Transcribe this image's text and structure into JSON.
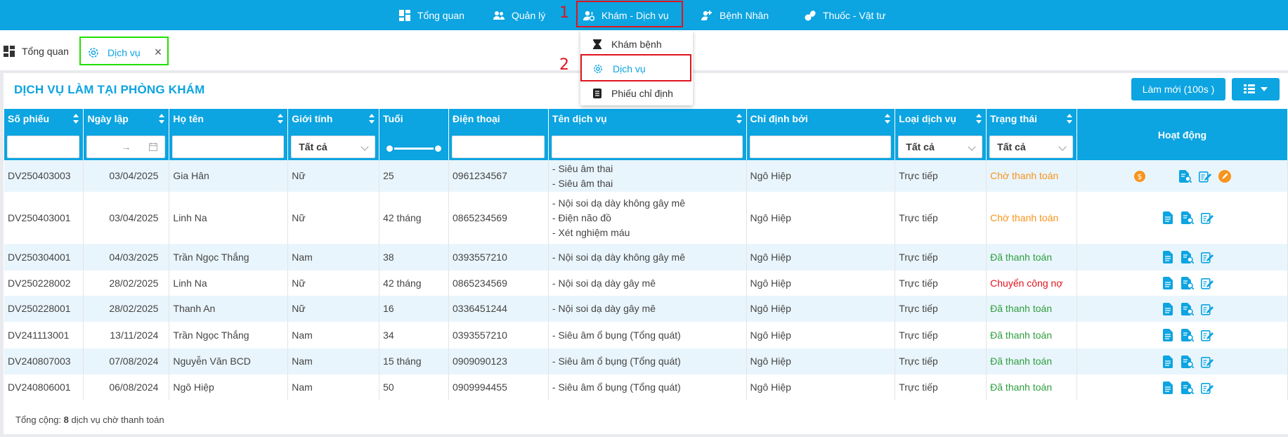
{
  "nav": {
    "items": [
      {
        "label": "Tổng quan",
        "icon": "dashboard-icon"
      },
      {
        "label": "Quản lý",
        "icon": "users-icon"
      },
      {
        "label": "Khám - Dịch vụ",
        "icon": "user-service-icon"
      },
      {
        "label": "Bệnh Nhân",
        "icon": "patient-icon"
      },
      {
        "label": "Thuốc - Vật tư",
        "icon": "medicine-icon"
      }
    ]
  },
  "annotations": {
    "step1": "1",
    "step2": "2"
  },
  "tabs": [
    {
      "label": "Tổng quan",
      "icon": "dashboard-icon"
    },
    {
      "label": "Dịch vụ",
      "icon": "gear-icon",
      "close": "×"
    }
  ],
  "dropdown": {
    "items": [
      {
        "label": "Khám bệnh",
        "icon": "hourglass-icon"
      },
      {
        "label": "Dịch vụ",
        "icon": "gear-icon"
      },
      {
        "label": "Phiếu chỉ định",
        "icon": "document-icon"
      }
    ]
  },
  "page": {
    "title": "DỊCH VỤ LÀM TẠI PHÒNG KHÁM",
    "refresh_label": "Làm mới (100s )"
  },
  "table": {
    "headers": [
      "Số phiếu",
      "Ngày lập",
      "Họ tên",
      "Giới tính",
      "Tuổi",
      "Điện thoại",
      "Tên dịch vụ",
      "Chỉ định bởi",
      "Loại dịch vụ",
      "Trạng thái",
      "Hoạt động"
    ],
    "filters": {
      "gioitinh": "Tất cả",
      "loaidv": "Tất cả",
      "trangthai": "Tất cả",
      "date_arrow": "→"
    },
    "rows": [
      {
        "so": "DV250403003",
        "ngay": "03/04/2025",
        "ten": "Gia Hân",
        "gt": "Nữ",
        "tuoi": "25",
        "dt": "0961234567",
        "dv": [
          "- Siêu âm thai",
          "- Siêu âm thai"
        ],
        "cd": "Ngô Hiệp",
        "loai": "Trực tiếp",
        "tt": "Chờ thanh toán",
        "tt_color": "#f7941d"
      },
      {
        "so": "DV250403001",
        "ngay": "03/04/2025",
        "ten": "Linh Na",
        "gt": "Nữ",
        "tuoi": "42 tháng",
        "dt": "0865234569",
        "dv": [
          "- Nội soi dạ dày không gây mê",
          "- Điện não đồ",
          "- Xét nghiệm máu"
        ],
        "cd": "Ngô Hiệp",
        "loai": "Trực tiếp",
        "tt": "Chờ thanh toán",
        "tt_color": "#f7941d"
      },
      {
        "so": "DV250304001",
        "ngay": "04/03/2025",
        "ten": "Trần Ngọc Thắng",
        "gt": "Nam",
        "tuoi": "38",
        "dt": "0393557210",
        "dv": [
          "- Nội soi dạ dày không gây mê"
        ],
        "cd": "Ngô Hiệp",
        "loai": "Trực tiếp",
        "tt": "Đã thanh toán",
        "tt_color": "#2e9e3e"
      },
      {
        "so": "DV250228002",
        "ngay": "28/02/2025",
        "ten": "Linh Na",
        "gt": "Nữ",
        "tuoi": "42 tháng",
        "dt": "0865234569",
        "dv": [
          "- Nội soi dạ dày gây mê"
        ],
        "cd": "Ngô Hiệp",
        "loai": "Trực tiếp",
        "tt": "Chuyển công nợ",
        "tt_color": "#e0141e"
      },
      {
        "so": "DV250228001",
        "ngay": "28/02/2025",
        "ten": "Thanh An",
        "gt": "Nữ",
        "tuoi": "16",
        "dt": "0336451244",
        "dv": [
          "- Nội soi dạ dày gây mê"
        ],
        "cd": "Ngô Hiệp",
        "loai": "Trực tiếp",
        "tt": "Đã thanh toán",
        "tt_color": "#2e9e3e"
      },
      {
        "so": "DV241113001",
        "ngay": "13/11/2024",
        "ten": "Trần Ngọc Thắng",
        "gt": "Nam",
        "tuoi": "34",
        "dt": "0393557210",
        "dv": [
          "- Siêu âm ổ bụng (Tổng quát)"
        ],
        "cd": "Ngô Hiệp",
        "loai": "Trực tiếp",
        "tt": "Đã thanh toán",
        "tt_color": "#2e9e3e"
      },
      {
        "so": "DV240807003",
        "ngay": "07/08/2024",
        "ten": "Nguyễn Văn BCD",
        "gt": "Nam",
        "tuoi": "15 tháng",
        "dt": "0909090123",
        "dv": [
          "- Siêu âm ổ bụng (Tổng quát)"
        ],
        "cd": "Ngô Hiệp",
        "loai": "Trực tiếp",
        "tt": "Đã thanh toán",
        "tt_color": "#2e9e3e"
      },
      {
        "so": "DV240806001",
        "ngay": "06/08/2024",
        "ten": "Ngô Hiệp",
        "gt": "Nam",
        "tuoi": "50",
        "dt": "0909994455",
        "dv": [
          "- Siêu âm ổ bụng (Tổng quát)"
        ],
        "cd": "Ngô Hiệp",
        "loai": "Trực tiếp",
        "tt": "Đã thanh toán",
        "tt_color": "#2e9e3e"
      }
    ]
  },
  "footer": {
    "prefix": "Tổng cộng: ",
    "count": "8",
    "suffix": " dịch vụ chờ thanh toán"
  },
  "colors": {
    "primary": "#0ca4e1",
    "pending": "#f7941d",
    "paid": "#2e9e3e",
    "debt": "#e0141e",
    "annotation": "#e0141e",
    "tab_highlight": "#22e000"
  }
}
